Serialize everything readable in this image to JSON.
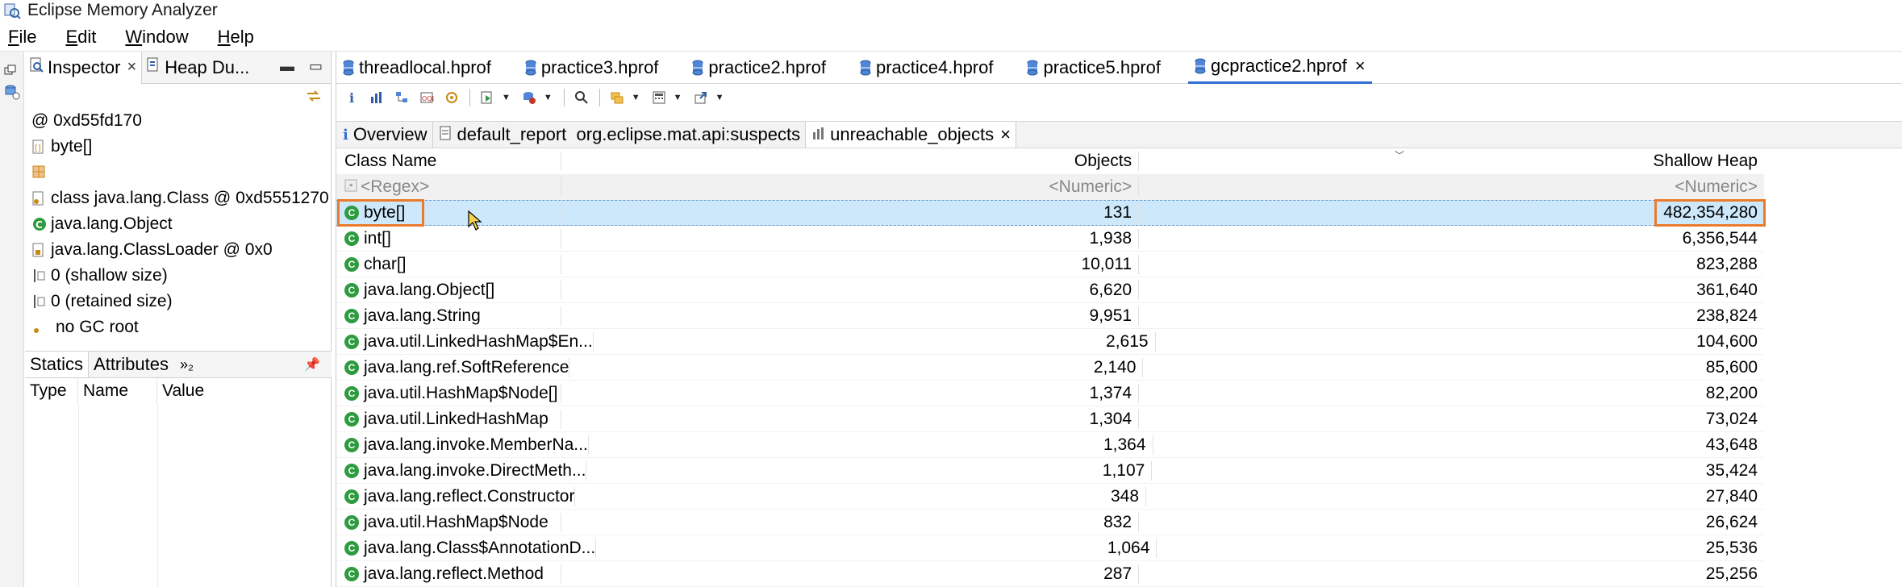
{
  "window": {
    "title": "Eclipse Memory Analyzer"
  },
  "menu": [
    {
      "label": "File",
      "mnemonic": "F",
      "rest": "ile"
    },
    {
      "label": "Edit",
      "mnemonic": "E",
      "rest": "dit"
    },
    {
      "label": "Window",
      "mnemonic": "W",
      "rest": "indow"
    },
    {
      "label": "Help",
      "mnemonic": "H",
      "rest": "elp"
    }
  ],
  "left_panel": {
    "tabs": [
      {
        "label": "Inspector",
        "close": "×"
      },
      {
        "label": "Heap Du..."
      }
    ],
    "inspector_rows": [
      {
        "icon": "at-icon",
        "text": "@ 0xd55fd170"
      },
      {
        "icon": "array-icon",
        "text": "byte[]"
      },
      {
        "icon": "grid-icon",
        "text": ""
      },
      {
        "icon": "class-file-icon",
        "text": "class java.lang.Class @ 0xd5551270"
      },
      {
        "icon": "class-icon",
        "text": "java.lang.Object"
      },
      {
        "icon": "classloader-icon",
        "text": "java.lang.ClassLoader @ 0x0"
      },
      {
        "icon": "size-icon",
        "text": "0 (shallow size)"
      },
      {
        "icon": "size-icon",
        "text": "0 (retained size)"
      },
      {
        "icon": "gc-root-icon",
        "text": "no GC root"
      }
    ],
    "lower_tabs": {
      "statics": "Statics",
      "attributes": "Attributes",
      "more": "»₂"
    },
    "attr_columns": {
      "type": "Type",
      "name": "Name",
      "value": "Value"
    }
  },
  "file_tabs": [
    {
      "label": "threadlocal.hprof"
    },
    {
      "label": "practice3.hprof"
    },
    {
      "label": "practice2.hprof"
    },
    {
      "label": "practice4.hprof"
    },
    {
      "label": "practice5.hprof"
    },
    {
      "label": "gcpractice2.hprof",
      "close": "×"
    }
  ],
  "sub_tabs": [
    {
      "label": "Overview",
      "icon": "i"
    },
    {
      "label": "default_report  org.eclipse.mat.api:suspects"
    },
    {
      "label": "unreachable_objects",
      "close": "×"
    }
  ],
  "table": {
    "headers": {
      "class_name": "Class Name",
      "objects": "Objects",
      "shallow_heap": "Shallow Heap"
    },
    "filter": {
      "class_name": "<Regex>",
      "objects": "<Numeric>",
      "shallow_heap": "<Numeric>"
    },
    "rows": [
      {
        "name": "byte[]",
        "objects": "131",
        "shallow": "482,354,280"
      },
      {
        "name": "int[]",
        "objects": "1,938",
        "shallow": "6,356,544"
      },
      {
        "name": "char[]",
        "objects": "10,011",
        "shallow": "823,288"
      },
      {
        "name": "java.lang.Object[]",
        "objects": "6,620",
        "shallow": "361,640"
      },
      {
        "name": "java.lang.String",
        "objects": "9,951",
        "shallow": "238,824"
      },
      {
        "name": "java.util.LinkedHashMap$En...",
        "objects": "2,615",
        "shallow": "104,600"
      },
      {
        "name": "java.lang.ref.SoftReference",
        "objects": "2,140",
        "shallow": "85,600"
      },
      {
        "name": "java.util.HashMap$Node[]",
        "objects": "1,374",
        "shallow": "82,200"
      },
      {
        "name": "java.util.LinkedHashMap",
        "objects": "1,304",
        "shallow": "73,024"
      },
      {
        "name": "java.lang.invoke.MemberNa...",
        "objects": "1,364",
        "shallow": "43,648"
      },
      {
        "name": "java.lang.invoke.DirectMeth...",
        "objects": "1,107",
        "shallow": "35,424"
      },
      {
        "name": "java.lang.reflect.Constructor",
        "objects": "348",
        "shallow": "27,840"
      },
      {
        "name": "java.util.HashMap$Node",
        "objects": "832",
        "shallow": "26,624"
      },
      {
        "name": "java.lang.Class$AnnotationD...",
        "objects": "1,064",
        "shallow": "25,536"
      },
      {
        "name": "java.lang.reflect.Method",
        "objects": "287",
        "shallow": "25,256"
      }
    ]
  },
  "colors": {
    "highlight": "#ea7b2b",
    "selection": "#cde8fb",
    "class_icon": "#2e9b3e"
  }
}
